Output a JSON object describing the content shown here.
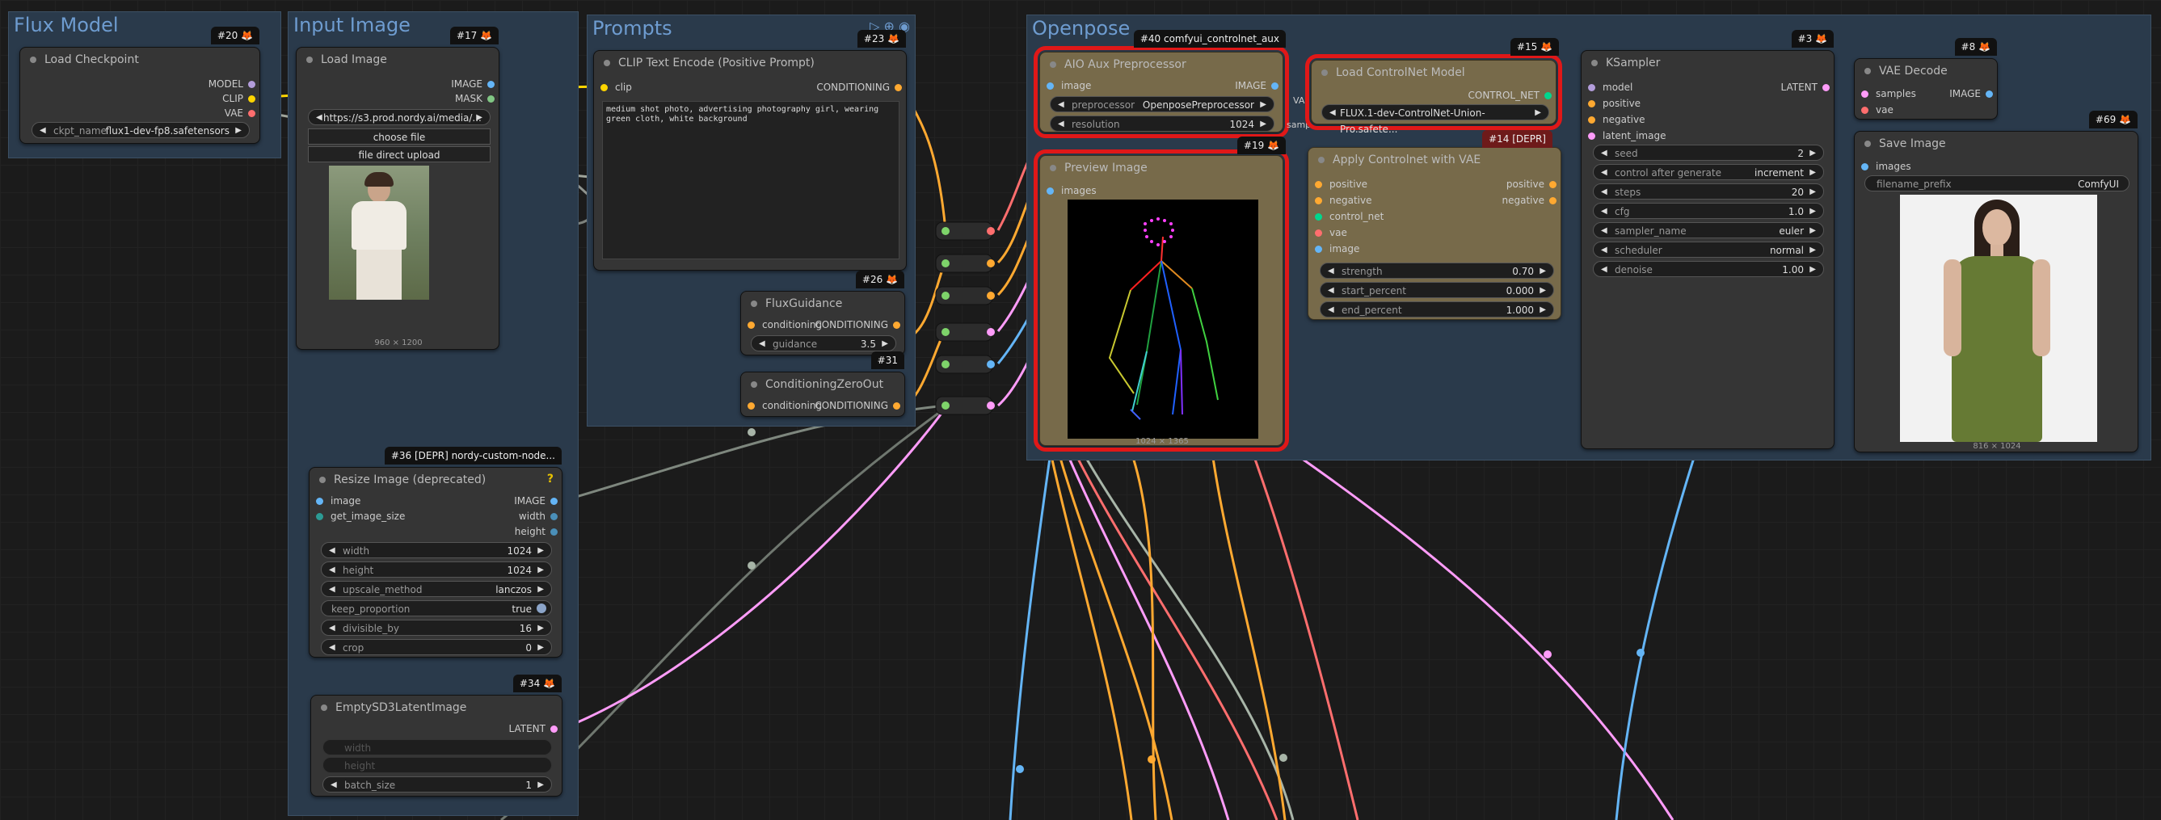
{
  "colors": {
    "model": "#b39ddb",
    "clip": "#ffd500",
    "vae": "#ff6e6e",
    "image": "#64b5f6",
    "latent": "#ff9cf9",
    "conditioning": "#ffa931",
    "control_net": "#00d78d",
    "mask": "#81c784",
    "highlight": "#e01818"
  },
  "groups": {
    "flux_model": "Flux Model",
    "input_image": "Input Image",
    "prompts": "Prompts",
    "openpose": "Openpose"
  },
  "load_checkpoint": {
    "badge": "#20 🦊",
    "title": "Load Checkpoint",
    "out_model": "MODEL",
    "out_clip": "CLIP",
    "out_vae": "VAE",
    "w_label": "ckpt_name",
    "w_value": "flux1-dev-fp8.safetensors"
  },
  "load_image": {
    "badge": "#17 🦊",
    "title": "Load Image",
    "out_image": "IMAGE",
    "out_mask": "MASK",
    "url": "https://s3.prod.nordy.ai/media/...",
    "choose": "choose file",
    "upload": "file direct upload",
    "size": "960 × 1200",
    "photo_icon": "woman-in-white-lace-blouse-photo"
  },
  "clip_text": {
    "badge": "#23 🦊",
    "title": "CLIP Text Encode (Positive Prompt)",
    "in_clip": "clip",
    "out": "CONDITIONING",
    "text": "medium shot photo, advertising photography girl, wearing green cloth, white background"
  },
  "flux_guidance": {
    "badge": "#26 🦊",
    "title": "FluxGuidance",
    "in": "conditioning",
    "out": "CONDITIONING",
    "w_label": "guidance",
    "w_value": "3.5"
  },
  "cond_zero": {
    "badge": "#31",
    "title": "ConditioningZeroOut",
    "in": "conditioning",
    "out": "CONDITIONING"
  },
  "resize": {
    "badge": "#36 [DEPR] nordy-custom-node...",
    "title": "Resize Image (deprecated)",
    "help": "?",
    "in_image": "image",
    "in_size": "get_image_size",
    "out_image": "IMAGE",
    "out_width": "width",
    "out_height": "height",
    "widgets": [
      {
        "label": "width",
        "value": "1024"
      },
      {
        "label": "height",
        "value": "1024"
      },
      {
        "label": "upscale_method",
        "value": "lanczos"
      },
      {
        "label": "keep_proportion",
        "value": "true"
      },
      {
        "label": "divisible_by",
        "value": "16"
      },
      {
        "label": "crop",
        "value": "0"
      }
    ]
  },
  "empty_latent": {
    "badge": "#34 🦊",
    "title": "EmptySD3LatentImage",
    "out": "LATENT",
    "w_width": "width",
    "w_height": "height",
    "w_batch": "batch_size",
    "batch_value": "1"
  },
  "aio": {
    "badge": "#40 comfyui_controlnet_aux",
    "title": "AIO Aux Preprocessor",
    "in_image": "image",
    "out": "IMAGE",
    "w1_label": "preprocessor",
    "w1_value": "OpenposePreprocessor",
    "w2_label": "resolution",
    "w2_value": "1024"
  },
  "preview": {
    "badge": "#19 🦊",
    "title": "Preview Image",
    "in": "images",
    "size": "1024 × 1365"
  },
  "load_cn": {
    "badge": "#15 🦊",
    "title": "Load ControlNet Model",
    "out": "CONTROL_NET",
    "w_value": "FLUX.1-dev-ControlNet-Union-Pro.safete..."
  },
  "apply_cn": {
    "badge": "#14 [DEPR]",
    "title": "Apply Controlnet with VAE",
    "in_pos": "positive",
    "in_neg": "negative",
    "in_cn": "control_net",
    "in_vae": "vae",
    "in_image": "image",
    "out_pos": "positive",
    "out_neg": "negative",
    "widgets": [
      {
        "label": "strength",
        "value": "0.70"
      },
      {
        "label": "start_percent",
        "value": "0.000"
      },
      {
        "label": "end_percent",
        "value": "1.000"
      }
    ]
  },
  "ksampler": {
    "badge": "#3 🦊",
    "title": "KSampler",
    "in_model": "model",
    "in_pos": "positive",
    "in_neg": "negative",
    "in_latent": "latent_image",
    "out": "LATENT",
    "widgets": [
      {
        "label": "seed",
        "value": "2"
      },
      {
        "label": "control after generate",
        "value": "increment"
      },
      {
        "label": "steps",
        "value": "20"
      },
      {
        "label": "cfg",
        "value": "1.0"
      },
      {
        "label": "sampler_name",
        "value": "euler"
      },
      {
        "label": "scheduler",
        "value": "normal"
      },
      {
        "label": "denoise",
        "value": "1.00"
      }
    ]
  },
  "vae_decode": {
    "badge": "#8 🦊",
    "title": "VAE Decode",
    "in_samples": "samples",
    "in_vae": "vae",
    "out": "IMAGE"
  },
  "save_image": {
    "badge": "#69 🦊",
    "title": "Save Image",
    "in": "images",
    "w_label": "filename_prefix",
    "w_value": "ComfyUI",
    "size": "816 × 1024",
    "photo_icon": "woman-in-green-dress-photo"
  },
  "partial": {
    "samp": "samp",
    "va": "VA"
  }
}
